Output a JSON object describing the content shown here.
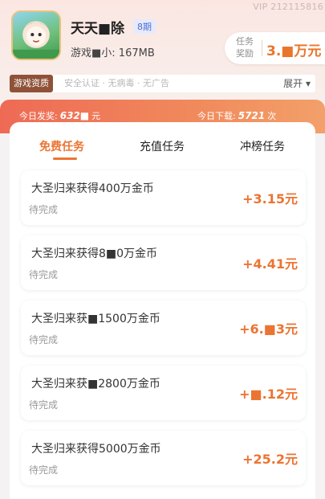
{
  "header": {
    "vip_id": "VIP 212115816",
    "app_title": "天天■除",
    "period_badge": "8期",
    "app_info": "游戏■小: 167MB",
    "reward_label": "任务奖励",
    "reward_value": "3.■万元"
  },
  "qualification": {
    "badge": "游戏资质",
    "text": "安全认证 · 无病毒 · 无广告",
    "expand": "展开 ▾"
  },
  "stats": {
    "payout_label": "今日发奖:",
    "payout_value": "632■",
    "payout_unit": "元",
    "download_label": "今日下载:",
    "download_value": "5721",
    "download_unit": "次"
  },
  "tabs": [
    {
      "label": "免费任务",
      "active": true
    },
    {
      "label": "充值任务",
      "active": false
    },
    {
      "label": "冲榜任务",
      "active": false
    }
  ],
  "tasks": [
    {
      "title": "大圣归来获得400万金币",
      "status": "待完成",
      "reward": "+3.15元"
    },
    {
      "title": "大圣归来获得8■0万金币",
      "status": "待完成",
      "reward": "+4.41元"
    },
    {
      "title": "大圣归来获■1500万金币",
      "status": "待完成",
      "reward": "+6.■3元"
    },
    {
      "title": "大圣归来获■2800万金币",
      "status": "待完成",
      "reward": "+■.12元"
    },
    {
      "title": "大圣归来获得5000万金币",
      "status": "待完成",
      "reward": "+25.2元"
    }
  ],
  "colors": {
    "accent": "#ec7432",
    "badge_brown": "#8f5238",
    "stats_gradient_start": "#ee6a55",
    "stats_gradient_end": "#f3a06a"
  }
}
